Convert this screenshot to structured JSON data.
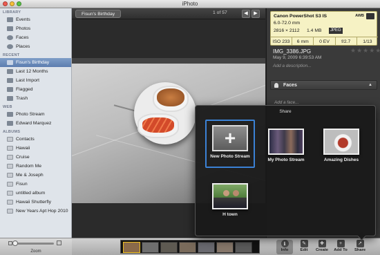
{
  "window": {
    "title": "iPhoto",
    "traffic_light_colors": [
      "#ee5b50",
      "#f7c13a",
      "#59c345"
    ]
  },
  "sidebar": {
    "sections": [
      {
        "heading": "LIBRARY",
        "items": [
          {
            "label": "Events",
            "icon": "events-icon"
          },
          {
            "label": "Photos",
            "icon": "photos-icon"
          },
          {
            "label": "Faces",
            "icon": "faces-icon"
          },
          {
            "label": "Places",
            "icon": "places-icon"
          }
        ]
      },
      {
        "heading": "RECENT",
        "items": [
          {
            "label": "Fisun's Birthday",
            "icon": "event-icon",
            "selected": true
          },
          {
            "label": "Last 12 Months",
            "icon": "calendar-icon"
          },
          {
            "label": "Last Import",
            "icon": "import-icon"
          },
          {
            "label": "Flagged",
            "icon": "flag-icon"
          },
          {
            "label": "Trash",
            "icon": "trash-icon"
          }
        ]
      },
      {
        "heading": "WEB",
        "items": [
          {
            "label": "Photo Stream",
            "icon": "photo-stream-icon"
          },
          {
            "label": "Edward Marquez",
            "icon": "web-account-icon"
          }
        ]
      },
      {
        "heading": "ALBUMS",
        "items": [
          {
            "label": "Contacts",
            "icon": "album-icon"
          },
          {
            "label": "Hawaii",
            "icon": "album-icon"
          },
          {
            "label": "Cruise",
            "icon": "album-icon"
          },
          {
            "label": "Random Me",
            "icon": "album-icon"
          },
          {
            "label": "Me & Joseph",
            "icon": "album-icon"
          },
          {
            "label": "Fisun",
            "icon": "album-icon"
          },
          {
            "label": "untitled album",
            "icon": "album-icon"
          },
          {
            "label": "Hawaii Shutterfly",
            "icon": "album-icon"
          },
          {
            "label": "New Years Apt Hop 2010",
            "icon": "album-icon"
          }
        ]
      }
    ],
    "selection_color": "#6b8bbd",
    "zoom_label": "Zoom"
  },
  "viewer": {
    "event_name": "Fisun's Birthday",
    "counter": "1 of 57",
    "prev_icon": "◀",
    "next_icon": "▶"
  },
  "info": {
    "camera_model": "Canon PowerShot S3 IS",
    "lens": "6.0-72.0 mm",
    "resolution": "2816 × 2112",
    "file_size": "1.4 MB",
    "format": "JPEG",
    "white_balance": "AWB",
    "stats": [
      "ISO 233",
      "6 mm",
      "0 EV",
      "f/2.7",
      "1/13"
    ],
    "filename": "IMG_3386.JPG",
    "date": "May 9, 2009 6:39:53 AM",
    "stars": "★★★★★",
    "description_placeholder": "Add a description...",
    "faces_label": "Faces",
    "faces_toggle": "▲",
    "add_face": "Add a face..."
  },
  "share_popover": {
    "title": "Share",
    "options": [
      {
        "label": "New Photo Stream",
        "plus": "+"
      },
      {
        "label": "My Photo Stream"
      },
      {
        "label": "Amazing Dishes"
      },
      {
        "label": "H town"
      }
    ],
    "highlight_color": "#3b82d6"
  },
  "toolbar": {
    "tools": [
      {
        "label": "Info",
        "icon": "i"
      },
      {
        "label": "Edit",
        "icon": "✎"
      },
      {
        "label": "Create",
        "icon": "✚"
      },
      {
        "label": "Add To",
        "icon": "+"
      },
      {
        "label": "Share",
        "icon": "↗"
      }
    ],
    "thumb_colors": [
      "#8a6a4a",
      "#6f6f6f",
      "#5e5a52",
      "#7a6b5b",
      "#6a6a70",
      "#86776a",
      "#5a5a5a"
    ]
  }
}
